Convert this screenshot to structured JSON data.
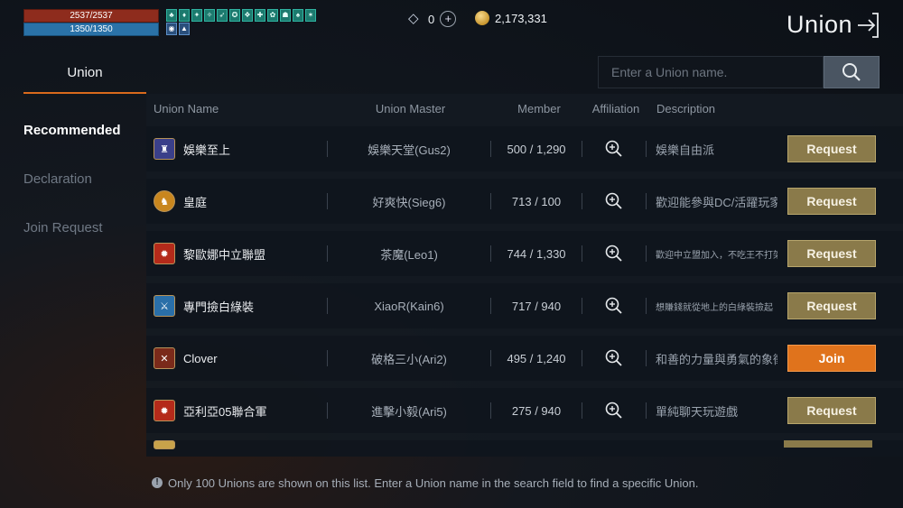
{
  "hud": {
    "hp": "2537/2537",
    "mp": "1350/1350",
    "hp_fraction": 1.0,
    "mp_fraction": 1.0
  },
  "currency": {
    "gems": "0",
    "gold": "2,173,331"
  },
  "window": {
    "title": "Union"
  },
  "nav": {
    "tab": "Union",
    "items": [
      {
        "label": "Recommended",
        "active": true
      },
      {
        "label": "Declaration",
        "active": false
      },
      {
        "label": "Join Request",
        "active": false
      }
    ]
  },
  "search": {
    "placeholder": "Enter a Union name."
  },
  "table": {
    "headers": {
      "name": "Union Name",
      "master": "Union Master",
      "member": "Member",
      "affiliation": "Affiliation",
      "description": "Description"
    },
    "rows": [
      {
        "name": "娛樂至上",
        "master": "娛樂天堂(Gus2)",
        "member": "500 / 1,290",
        "description": "娛樂自由派",
        "button": "Request",
        "emblem_color": "#3a3f8a"
      },
      {
        "name": "皇庭",
        "master": "好爽快(Sieg6)",
        "member": "713 / 100",
        "description": "歡迎能參與DC/活躍玩家",
        "button": "Request",
        "emblem_color": "#c8861e"
      },
      {
        "name": "黎歐娜中立聯盟",
        "master": "茶魔(Leo1)",
        "member": "744 / 1,330",
        "description": "歡迎中立盟加入，不吃王不打架",
        "button": "Request",
        "emblem_color": "#b42a1a"
      },
      {
        "name": "專門撿白綠裝",
        "master": "XiaoR(Kain6)",
        "member": "717 / 940",
        "description": "想賺錢就從地上的白綠裝撿起",
        "button": "Request",
        "emblem_color": "#2a6fa8"
      },
      {
        "name": "Clover",
        "master": "破格三小(Ari2)",
        "member": "495 / 1,240",
        "description": "和善的力量與勇氣的象徵",
        "button": "Join",
        "emblem_color": "#7a2a1a"
      },
      {
        "name": "亞利亞05聯合軍",
        "master": "進擊小毅(Ari5)",
        "member": "275 / 940",
        "description": "單純聊天玩遊戲",
        "button": "Request",
        "emblem_color": "#b42a1a"
      }
    ]
  },
  "info": {
    "text": "Only 100 Unions are shown on this list. Enter a Union name in the search field to find a specific Union."
  }
}
